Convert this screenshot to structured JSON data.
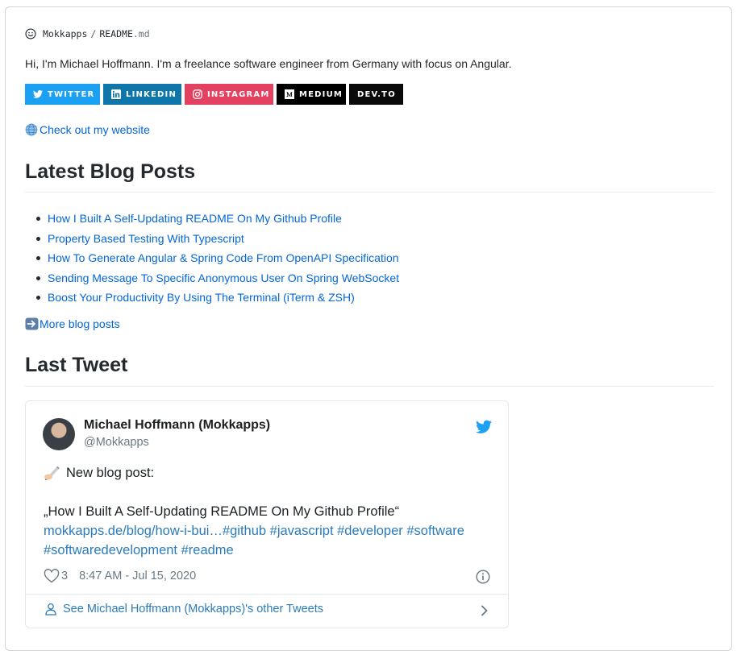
{
  "header": {
    "owner": "Mokkapps",
    "separator": "/",
    "file_base": "README",
    "file_ext": ".md"
  },
  "intro": "Hi, I'm Michael Hoffmann. I'm a freelance software engineer from Germany with focus on Angular.",
  "badges": [
    {
      "label": "TWITTER",
      "color": "#1ca0f2",
      "icon": "twitter-icon"
    },
    {
      "label": "LINKEDIN",
      "color": "#0e76a8",
      "icon": "linkedin-icon"
    },
    {
      "label": "INSTAGRAM",
      "color": "#e4405f",
      "icon": "instagram-icon"
    },
    {
      "label": "MEDIUM",
      "color": "#000000",
      "icon": "medium-icon"
    },
    {
      "label": "DEV.TO",
      "color": "#0a0a0a",
      "icon": ""
    }
  ],
  "website_link": "Check out my website",
  "blog": {
    "heading": "Latest Blog Posts",
    "posts": [
      "How I Built A Self-Updating README On My Github Profile",
      "Property Based Testing With Typescript",
      "How To Generate Angular & Spring Code From OpenAPI Specification",
      "Sending Message To Specific Anonymous User On Spring WebSocket",
      "Boost Your Productivity By Using The Terminal (iTerm & ZSH)"
    ],
    "more_link": "More blog posts"
  },
  "tweet_section": {
    "heading": "Last Tweet",
    "tweet": {
      "name": "Michael Hoffmann (Mokkapps)",
      "handle": "@Mokkapps",
      "line1": "New blog post:",
      "line2": "„How I Built A Self-Updating README On My Github Profile“",
      "line3": "mokkapps.de/blog/how-i-bui…#github #javascript #developer #software",
      "line4": "#softwaredevelopment #readme",
      "likes": "3",
      "timestamp": "8:47 AM - Jul 15, 2020",
      "footer_link": "See Michael Hoffmann (Mokkapps)'s other Tweets"
    }
  },
  "colors": {
    "link": "#0366d6",
    "twitter_blue": "#1da1f2",
    "tweet_link": "#2b7bb9"
  }
}
